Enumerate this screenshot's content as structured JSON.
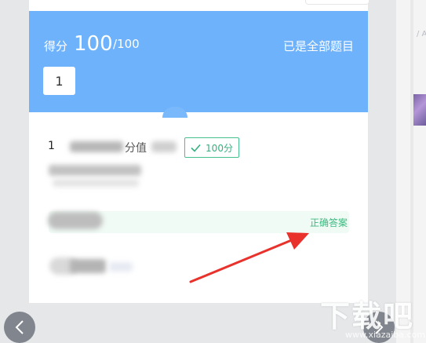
{
  "score": {
    "label": "得分",
    "value": "100",
    "total": "/100",
    "status": "已是全部题目"
  },
  "question_nav": {
    "current": "1"
  },
  "question": {
    "number_prefix": "1",
    "text_fragment": "分值",
    "score_badge": "100分",
    "score_badge_icon": "check-icon"
  },
  "answer": {
    "correct_label": "正确答案"
  },
  "watermark": {
    "brand": "下载吧",
    "url": "www.xiazaiba.com"
  },
  "right_panel": {
    "text": "/ AT"
  },
  "colors": {
    "header_blue": "#6eb2fc",
    "correct_green": "#3cb980",
    "annotation_red": "#e8322b"
  }
}
